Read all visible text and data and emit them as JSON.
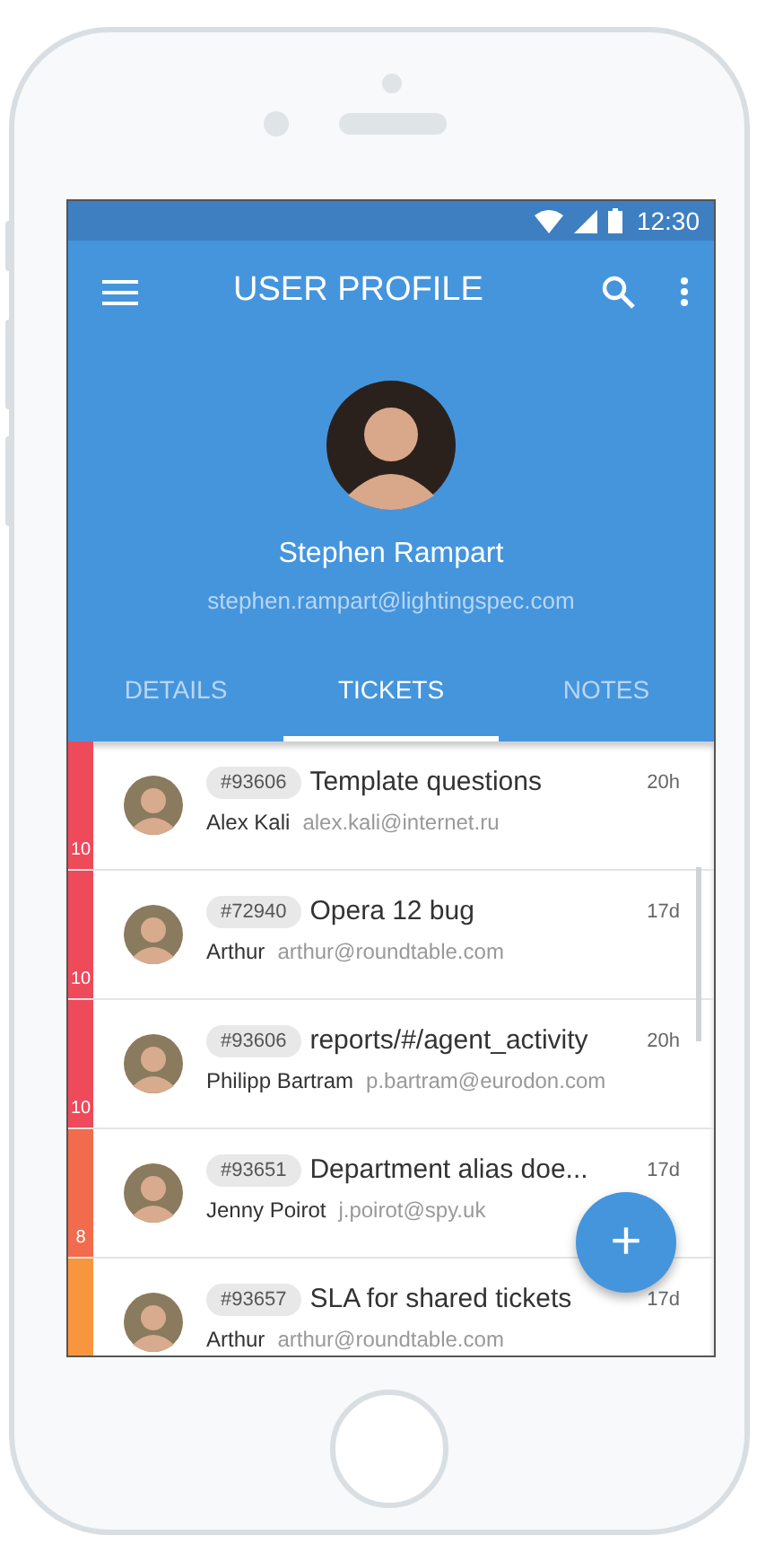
{
  "status_bar": {
    "time": "12:30"
  },
  "toolbar": {
    "title": "USER PROFILE"
  },
  "profile": {
    "name": "Stephen Rampart",
    "email": "stephen.rampart@lightingspec.com"
  },
  "tabs": [
    {
      "label": "DETAILS",
      "selected": false
    },
    {
      "label": "TICKETS",
      "selected": true
    },
    {
      "label": "NOTES",
      "selected": false
    }
  ],
  "tickets": [
    {
      "priority": "10",
      "color": "#ee4a5a",
      "id": "#93606",
      "subject": "Template questions",
      "age": "20h",
      "requester": "Alex Kali",
      "email": "alex.kali@internet.ru"
    },
    {
      "priority": "10",
      "color": "#ee4a5a",
      "id": "#72940",
      "subject": "Opera 12 bug",
      "age": "17d",
      "requester": "Arthur",
      "email": "arthur@roundtable.com"
    },
    {
      "priority": "10",
      "color": "#ee4a5a",
      "id": "#93606",
      "subject": "reports/#/agent_activity",
      "age": "20h",
      "requester": "Philipp Bartram",
      "email": "p.bartram@eurodon.com"
    },
    {
      "priority": "8",
      "color": "#f26b4c",
      "id": "#93651",
      "subject": "Department alias doe...",
      "age": "17d",
      "requester": "Jenny Poirot",
      "email": "j.poirot@spy.uk"
    },
    {
      "color": "#f7963f",
      "id": "#93657",
      "subject": "SLA for shared tickets",
      "age": "17d",
      "requester": "Arthur",
      "email": "arthur@roundtable.com"
    }
  ],
  "fab": {
    "label": "+"
  }
}
